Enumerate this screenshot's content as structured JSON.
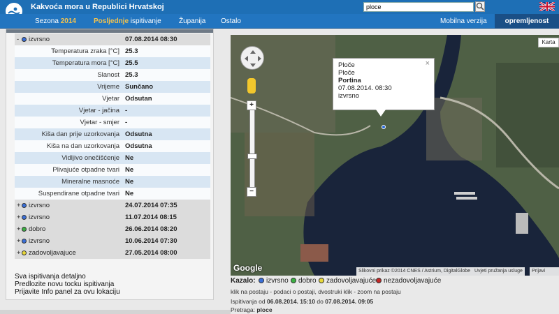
{
  "header": {
    "title": "Kakvoća mora u Republici Hrvatskoj",
    "search_value": "ploce"
  },
  "nav": {
    "sezona_prefix": "Sezona",
    "sezona_year": "2014",
    "posljednje_hl": "Posljednje",
    "posljednje_rest": "ispitivanje",
    "zupanija": "Županija",
    "ostalo": "Ostalo",
    "mobilna": "Mobilna verzija",
    "opremljenost": "opremljenost"
  },
  "detail": {
    "header_sign": "-",
    "header_status": "izvrsno",
    "header_date": "07.08.2014 08:30",
    "rows": [
      {
        "label": "Temperatura zraka [°C]",
        "value": "25.3"
      },
      {
        "label": "Temperatura mora [°C]",
        "value": "25.5"
      },
      {
        "label": "Slanost",
        "value": "25.3"
      },
      {
        "label": "Vrijeme",
        "value": "Sunčano"
      },
      {
        "label": "Vjetar",
        "value": "Odsutan"
      },
      {
        "label": "Vjetar - jačina",
        "value": "-"
      },
      {
        "label": "Vjetar - smjer",
        "value": "-"
      },
      {
        "label": "Kiša dan prije uzorkovanja",
        "value": "Odsutna"
      },
      {
        "label": "Kiša na dan uzorkovanja",
        "value": "Odsutna"
      },
      {
        "label": "Vidljivo onečišćenje",
        "value": "Ne"
      },
      {
        "label": "Plivajuće otpadne tvari",
        "value": "Ne"
      },
      {
        "label": "Mineralne masnoće",
        "value": "Ne"
      },
      {
        "label": "Suspendirane otpadne tvari",
        "value": "Ne"
      }
    ],
    "previous": [
      {
        "sign": "+",
        "status": "izvrsno",
        "date": "24.07.2014 07:35",
        "color": "#3a6fd8"
      },
      {
        "sign": "+",
        "status": "izvrsno",
        "date": "11.07.2014 08:15",
        "color": "#3a6fd8"
      },
      {
        "sign": "+",
        "status": "dobro",
        "date": "26.06.2014 08:20",
        "color": "#3cb043"
      },
      {
        "sign": "+",
        "status": "izvrsno",
        "date": "10.06.2014 07:30",
        "color": "#3a6fd8"
      },
      {
        "sign": "+",
        "status": "zadovoljavajuce",
        "date": "27.05.2014 08:00",
        "color": "#e8d83a"
      }
    ],
    "links": [
      "Sva ispitivanja detaljno",
      "Predlozite novu tocku ispitivanja",
      "Prijavite Info panel za ovu lokaciju"
    ]
  },
  "map": {
    "karta_label": "Karta",
    "info": {
      "line1": "Ploče",
      "line2": "Ploče",
      "name": "Portina",
      "datetime": "07.08.2014. 08:30",
      "status": "izvrsno",
      "close": "×"
    },
    "google": "Google",
    "credit1": "Slikovni prikaz ©2014 CNES / Astrium, DigitalGlobe",
    "credit2": "Uvjeti pružanja usluge",
    "credit3": "Prijavi pogre",
    "zoom_in": "+",
    "zoom_out": "−"
  },
  "legend": {
    "title": "Kazalo:",
    "items": [
      {
        "label": "izvrsno",
        "color": "#3a6fd8"
      },
      {
        "label": "dobro",
        "color": "#3cb043"
      },
      {
        "label": "zadovoljavajuće",
        "color": "#e8d83a"
      },
      {
        "label": "nezadovoljavajuće",
        "color": "#c62828"
      }
    ],
    "hint": "klik na postaju - podaci o postaji, dvostruki klik - zoom na postaju",
    "period_prefix": "Ispitivanja od",
    "period_from": "06.08.2014. 15:10",
    "period_mid": "do",
    "period_to": "07.08.2014. 09:05",
    "query_prefix": "Pretraga:",
    "query_value": "ploce"
  }
}
